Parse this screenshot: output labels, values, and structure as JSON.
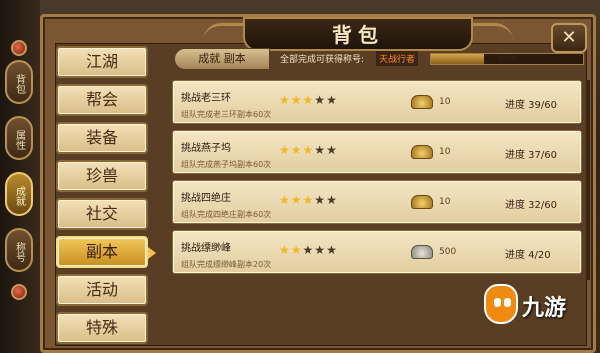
{
  "window": {
    "title": "背包",
    "close_glyph": "✕"
  },
  "vertical_tabs": [
    {
      "label": "背包",
      "active": false
    },
    {
      "label": "属性",
      "active": false
    },
    {
      "label": "成就",
      "active": true
    },
    {
      "label": "称号",
      "active": false
    }
  ],
  "menu": [
    {
      "label": "江湖",
      "active": false
    },
    {
      "label": "帮会",
      "active": false
    },
    {
      "label": "装备",
      "active": false
    },
    {
      "label": "珍兽",
      "active": false
    },
    {
      "label": "社交",
      "active": false
    },
    {
      "label": "副本",
      "active": true
    },
    {
      "label": "活动",
      "active": false
    },
    {
      "label": "特殊",
      "active": false
    }
  ],
  "header": {
    "breadcrumb": "成就  副本",
    "reward_label": "全部完成可获得称号:",
    "reward_value": "天战行者",
    "total_progress_text": "35%",
    "total_progress_fraction": 0.35
  },
  "tasks": [
    {
      "title": "挑战老三环",
      "desc": "组队完成老三环副本60次",
      "stars": 3,
      "max_stars": 5,
      "reward_type": "gold",
      "reward": "10",
      "progress": "进度 39/60"
    },
    {
      "title": "挑战燕子坞",
      "desc": "组队完成燕子坞副本60次",
      "stars": 3,
      "max_stars": 5,
      "reward_type": "gold",
      "reward": "10",
      "progress": "进度 37/60"
    },
    {
      "title": "挑战四绝庄",
      "desc": "组队完成四绝庄副本60次",
      "stars": 3,
      "max_stars": 5,
      "reward_type": "gold",
      "reward": "10",
      "progress": "进度 32/60"
    },
    {
      "title": "挑战缥缈峰",
      "desc": "组队完成缥缈峰副本20次",
      "stars": 2,
      "max_stars": 5,
      "reward_type": "silver",
      "reward": "500",
      "progress": "进度 4/20"
    }
  ],
  "watermark": {
    "text": "九游"
  },
  "colors": {
    "accent": "#f2c85a",
    "star_on": "#f0b624",
    "reward_highlight": "#ff8a24"
  }
}
